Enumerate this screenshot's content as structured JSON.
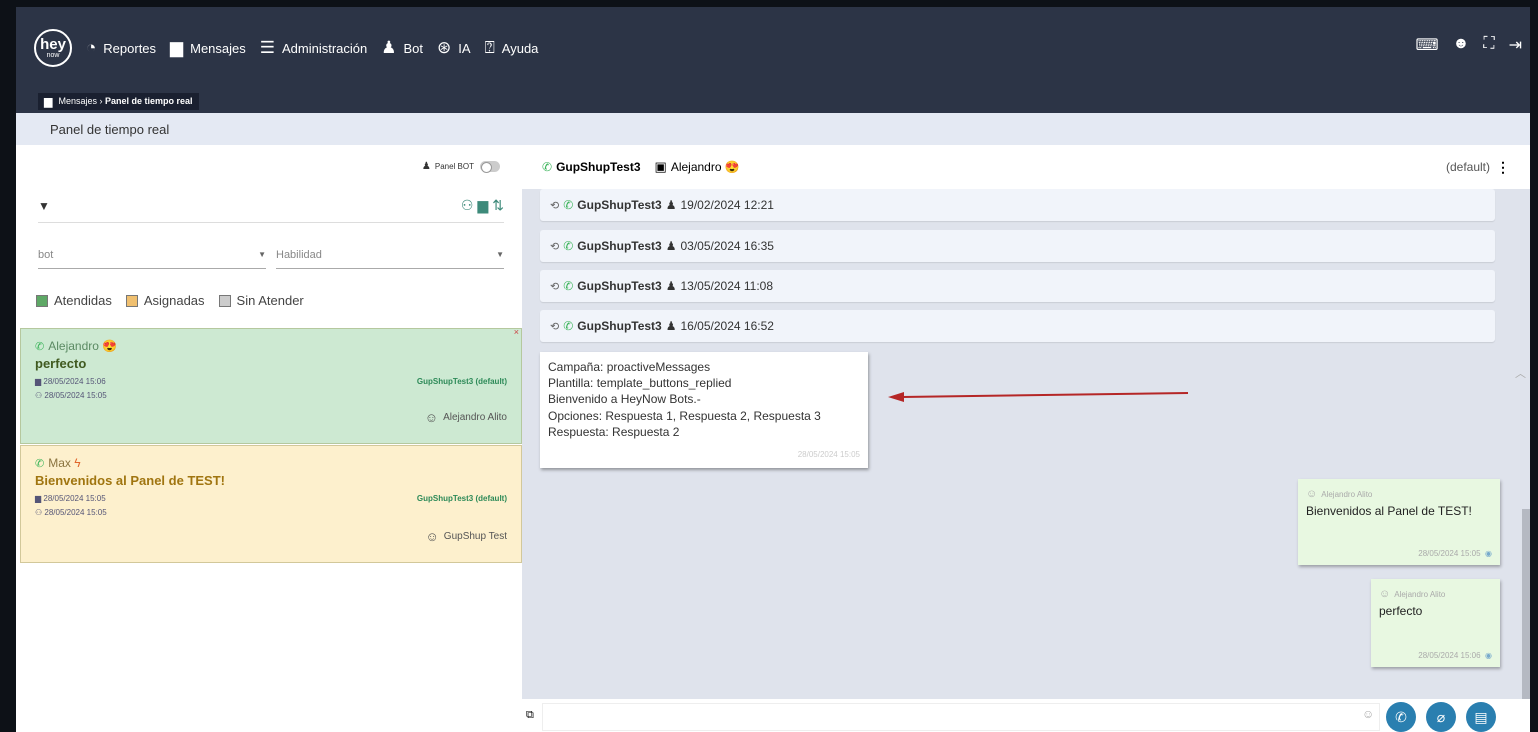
{
  "nav": {
    "logo_top": "hey",
    "logo_bottom": "now",
    "items": [
      {
        "label": "Reportes",
        "icon": "reports-icon",
        "glyph": "◔"
      },
      {
        "label": "Mensajes",
        "icon": "messages-icon",
        "glyph": "▆"
      },
      {
        "label": "Administración",
        "icon": "admin-icon",
        "glyph": "☰"
      },
      {
        "label": "Bot",
        "icon": "bot-icon",
        "glyph": "♟"
      },
      {
        "label": "IA",
        "icon": "ai-icon",
        "glyph": "⊛"
      },
      {
        "label": "Ayuda",
        "icon": "help-icon",
        "glyph": "⍰"
      }
    ]
  },
  "breadcrumb": {
    "parent": "Mensajes",
    "current": "Panel de tiempo real"
  },
  "page_title": "Panel de tiempo real",
  "left": {
    "panel_bot_label": "Panel BOT",
    "select_bot": "bot",
    "select_skill": "Habilidad",
    "legend": [
      {
        "label": "Atendidas",
        "color": "#5ea866"
      },
      {
        "label": "Asignadas",
        "color": "#f0c070"
      },
      {
        "label": "Sin Atender",
        "color": "#cccccc"
      }
    ],
    "conversations": [
      {
        "contact": "Alejandro",
        "message": "perfecto",
        "date1": "28/05/2024 15:06",
        "date2": "28/05/2024 15:05",
        "channel": "GupShupTest3 (default)",
        "agent": "Alejandro Alito"
      },
      {
        "contact": "Max",
        "message": "Bienvenidos al Panel de TEST!",
        "date1": "28/05/2024 15:05",
        "date2": "28/05/2024 15:05",
        "channel": "GupShupTest3 (default)",
        "agent": "GupShup Test"
      }
    ]
  },
  "chat": {
    "channel": "GupShupTest3",
    "contact": "Alejandro",
    "default_label": "(default)",
    "sessions": [
      {
        "channel": "GupShupTest3",
        "date": "19/02/2024 12:21"
      },
      {
        "channel": "GupShupTest3",
        "date": "03/05/2024 16:35"
      },
      {
        "channel": "GupShupTest3",
        "date": "13/05/2024 11:08"
      },
      {
        "channel": "GupShupTest3",
        "date": "16/05/2024 16:52"
      }
    ],
    "campaign": {
      "line1": "Campaña: proactiveMessages",
      "line2": "Plantilla: template_buttons_replied",
      "line3": "Bienvenido a HeyNow Bots.-",
      "line4": "Opciones: Respuesta 1, Respuesta 2, Respuesta 3",
      "line5": "Respuesta: Respuesta 2",
      "time": "28/05/2024 15:05"
    },
    "messages": [
      {
        "author": "Alejandro Alito",
        "text": "Bienvenidos al Panel de TEST!",
        "time": "28/05/2024 15:05"
      },
      {
        "author": "Alejandro Alito",
        "text": "perfecto",
        "time": "28/05/2024 15:06"
      }
    ]
  },
  "colors": {
    "nav_bg": "#2c3446",
    "accent": "#2a7fb0",
    "attended": "#cde9d2",
    "assigned": "#fdf0cd",
    "arrow": "#b52626"
  }
}
